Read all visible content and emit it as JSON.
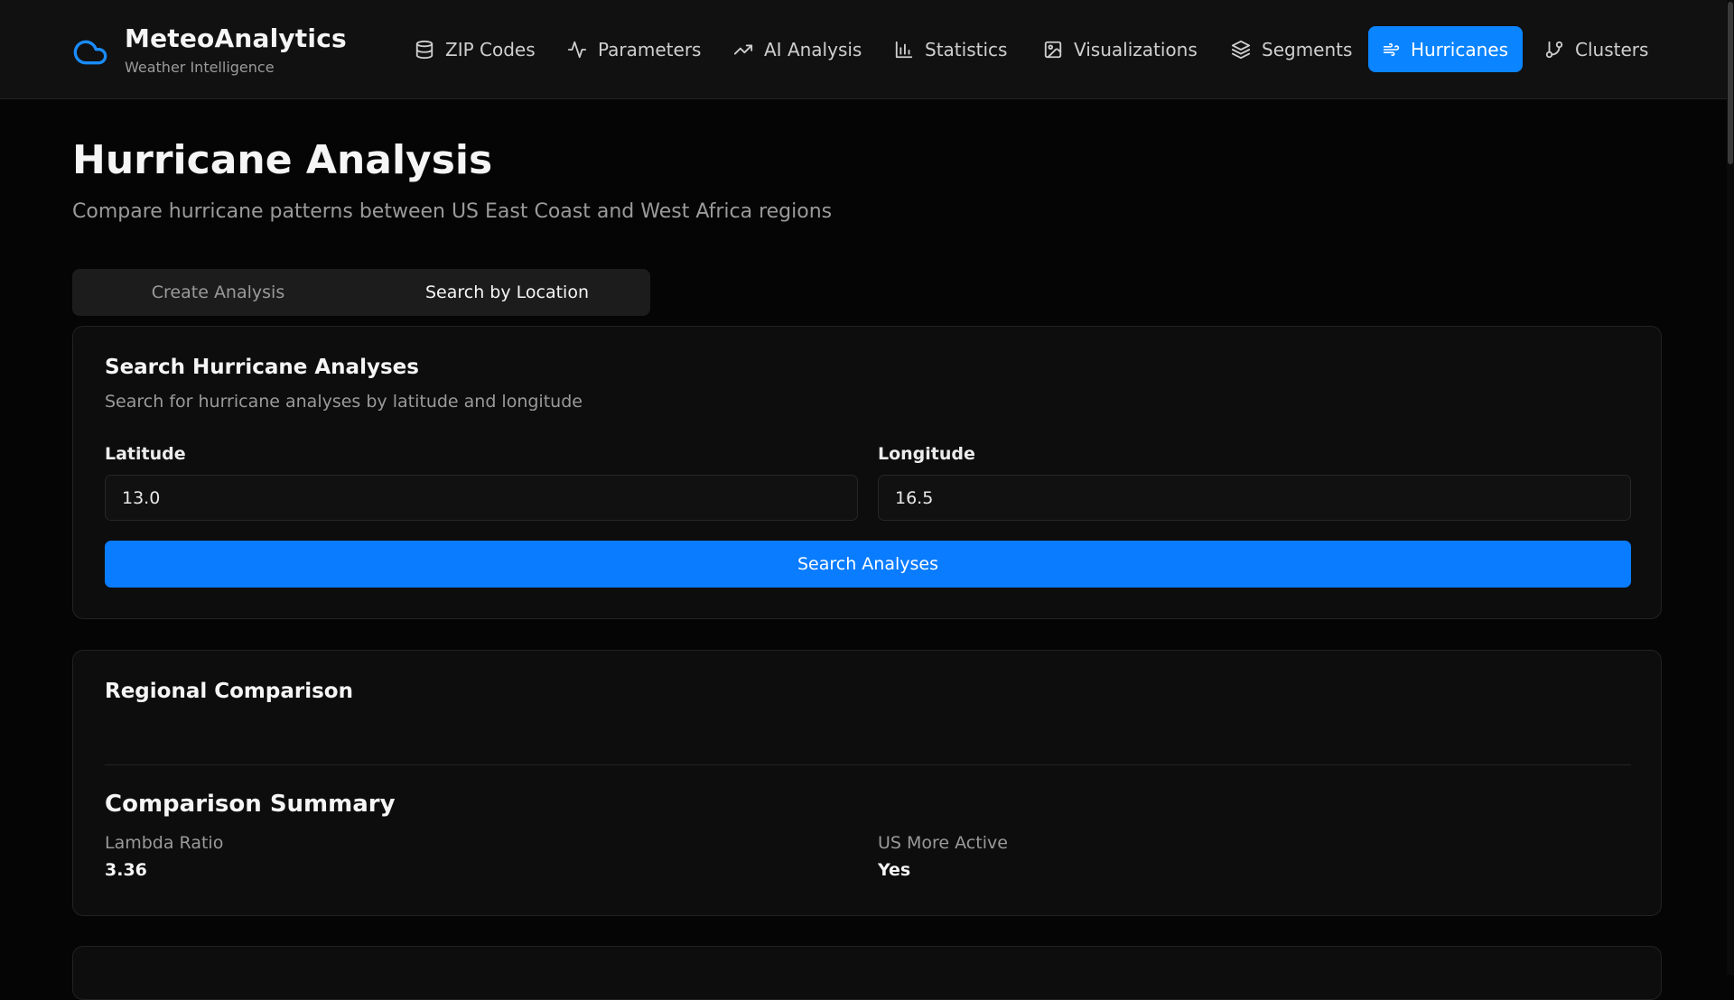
{
  "app": {
    "name": "MeteoAnalytics",
    "tagline": "Weather Intelligence",
    "logo_icon": "cloud-icon",
    "accent": "#0a84ff"
  },
  "nav": {
    "items": [
      {
        "label": "ZIP Codes",
        "icon": "database-icon",
        "active": false
      },
      {
        "label": "Parameters",
        "icon": "activity-icon",
        "active": false
      },
      {
        "label": "AI Analysis",
        "icon": "trending-up-icon",
        "active": false
      },
      {
        "label": "Statistics",
        "icon": "bar-chart-icon",
        "active": false
      },
      {
        "label": "Visualizations",
        "icon": "image-icon",
        "active": false
      },
      {
        "label": "Segments",
        "icon": "layers-icon",
        "active": false
      },
      {
        "label": "Hurricanes",
        "icon": "wind-icon",
        "active": true
      },
      {
        "label": "Clusters",
        "icon": "git-branch-icon",
        "active": false
      }
    ]
  },
  "page": {
    "title": "Hurricane Analysis",
    "subtitle": "Compare hurricane patterns between US East Coast and West Africa regions"
  },
  "tabs": [
    {
      "label": "Create Analysis",
      "active": false
    },
    {
      "label": "Search by Location",
      "active": true
    }
  ],
  "search_card": {
    "title": "Search Hurricane Analyses",
    "description": "Search for hurricane analyses by latitude and longitude",
    "latitude": {
      "label": "Latitude",
      "value": "13.0"
    },
    "longitude": {
      "label": "Longitude",
      "value": "16.5"
    },
    "button_label": "Search Analyses"
  },
  "comparison_card": {
    "title": "Regional Comparison",
    "summary_title": "Comparison Summary",
    "stats": [
      {
        "label": "Lambda Ratio",
        "value": "3.36"
      },
      {
        "label": "US More Active",
        "value": "Yes"
      }
    ]
  }
}
